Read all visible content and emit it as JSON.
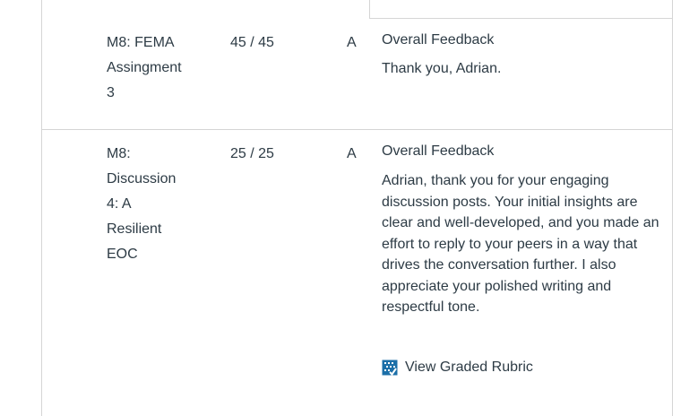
{
  "rows": [
    {
      "name_lines": [
        "M8: FEMA",
        "Assingment",
        "3"
      ],
      "score": "45 / 45",
      "grade": "A",
      "feedback_title": "Overall Feedback",
      "feedback_text": "Thank you, Adrian."
    },
    {
      "name_lines": [
        "M8:",
        "Discussion",
        "4: A",
        "Resilient",
        "EOC"
      ],
      "score": "25 / 25",
      "grade": "A",
      "feedback_title": "Overall Feedback",
      "feedback_text": "Adrian, thank you for your engaging discussion posts. Your initial insights are clear and well-developed, and you made an effort to reply to your peers in a way that drives the conversation further. I also appreciate your polished writing and respectful tone.",
      "rubric_link": "View Graded Rubric"
    }
  ],
  "colors": {
    "text": "#2d3b45",
    "border": "#d5d5d5",
    "rubric_icon": "#1c6fa8"
  },
  "icons": {
    "rubric": "rubric-icon"
  }
}
